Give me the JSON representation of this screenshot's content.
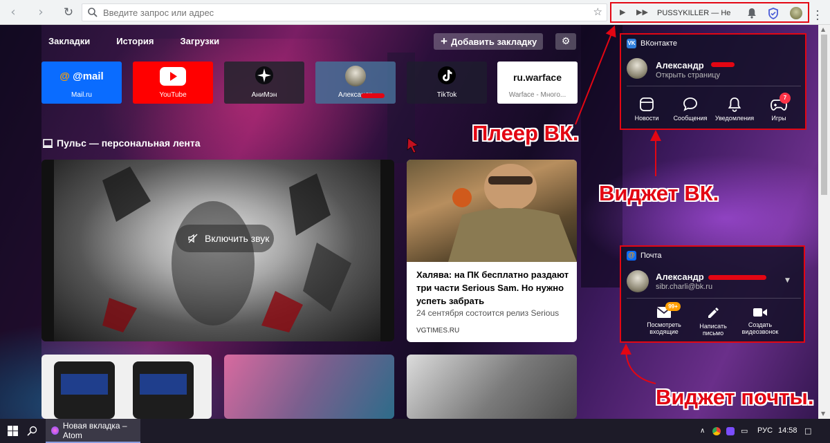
{
  "browser": {
    "address_placeholder": "Введите запрос или адрес",
    "player_track": "PUSSYKILLER — Не отлич"
  },
  "nav": {
    "bookmarks": "Закладки",
    "history": "История",
    "downloads": "Загрузки",
    "add_bookmark": "Добавить закладку"
  },
  "tiles": [
    {
      "label": "Mail.ru",
      "logo": "@mail"
    },
    {
      "label": "YouTube"
    },
    {
      "label": "АниМэн"
    },
    {
      "label": "Александр"
    },
    {
      "label": "TikTok"
    },
    {
      "label": "Warface - Много...",
      "logo": "ru.warface"
    }
  ],
  "pulse": {
    "title": "Пульс — персональная лента",
    "video_sound_button": "Включить звук",
    "news_title": "Халява: на ПК бесплатно раздают три части Serious Sam. Но нужно успеть забрать",
    "news_subtitle": "24 сентября состоится релиз Serious",
    "news_source": "VGTIMES.RU"
  },
  "vk_widget": {
    "header": "ВКонтакте",
    "user_name": "Александр",
    "open_page": "Открыть страницу",
    "actions": [
      "Новости",
      "Сообщения",
      "Уведомления",
      "Игры"
    ],
    "games_badge": "7"
  },
  "mail_widget": {
    "header": "Почта",
    "user_name": "Александр",
    "email": "sibr.charli@bk.ru",
    "actions": [
      "Посмотреть входящие",
      "Написать письмо",
      "Создать видеозвонок"
    ],
    "inbox_badge": "99+"
  },
  "annotations": {
    "player": "Плеер ВК.",
    "vk_widget": "Виджет ВК.",
    "mail_widget": "Виджет почты."
  },
  "taskbar": {
    "active_window": "Новая вкладка – Atom",
    "language": "РУС",
    "time": "14:58"
  },
  "colors": {
    "annotation_red": "#e30613",
    "mail_blue": "#0a6cff",
    "youtube_red": "#ff0000",
    "vk_blue": "#2f7edb"
  }
}
